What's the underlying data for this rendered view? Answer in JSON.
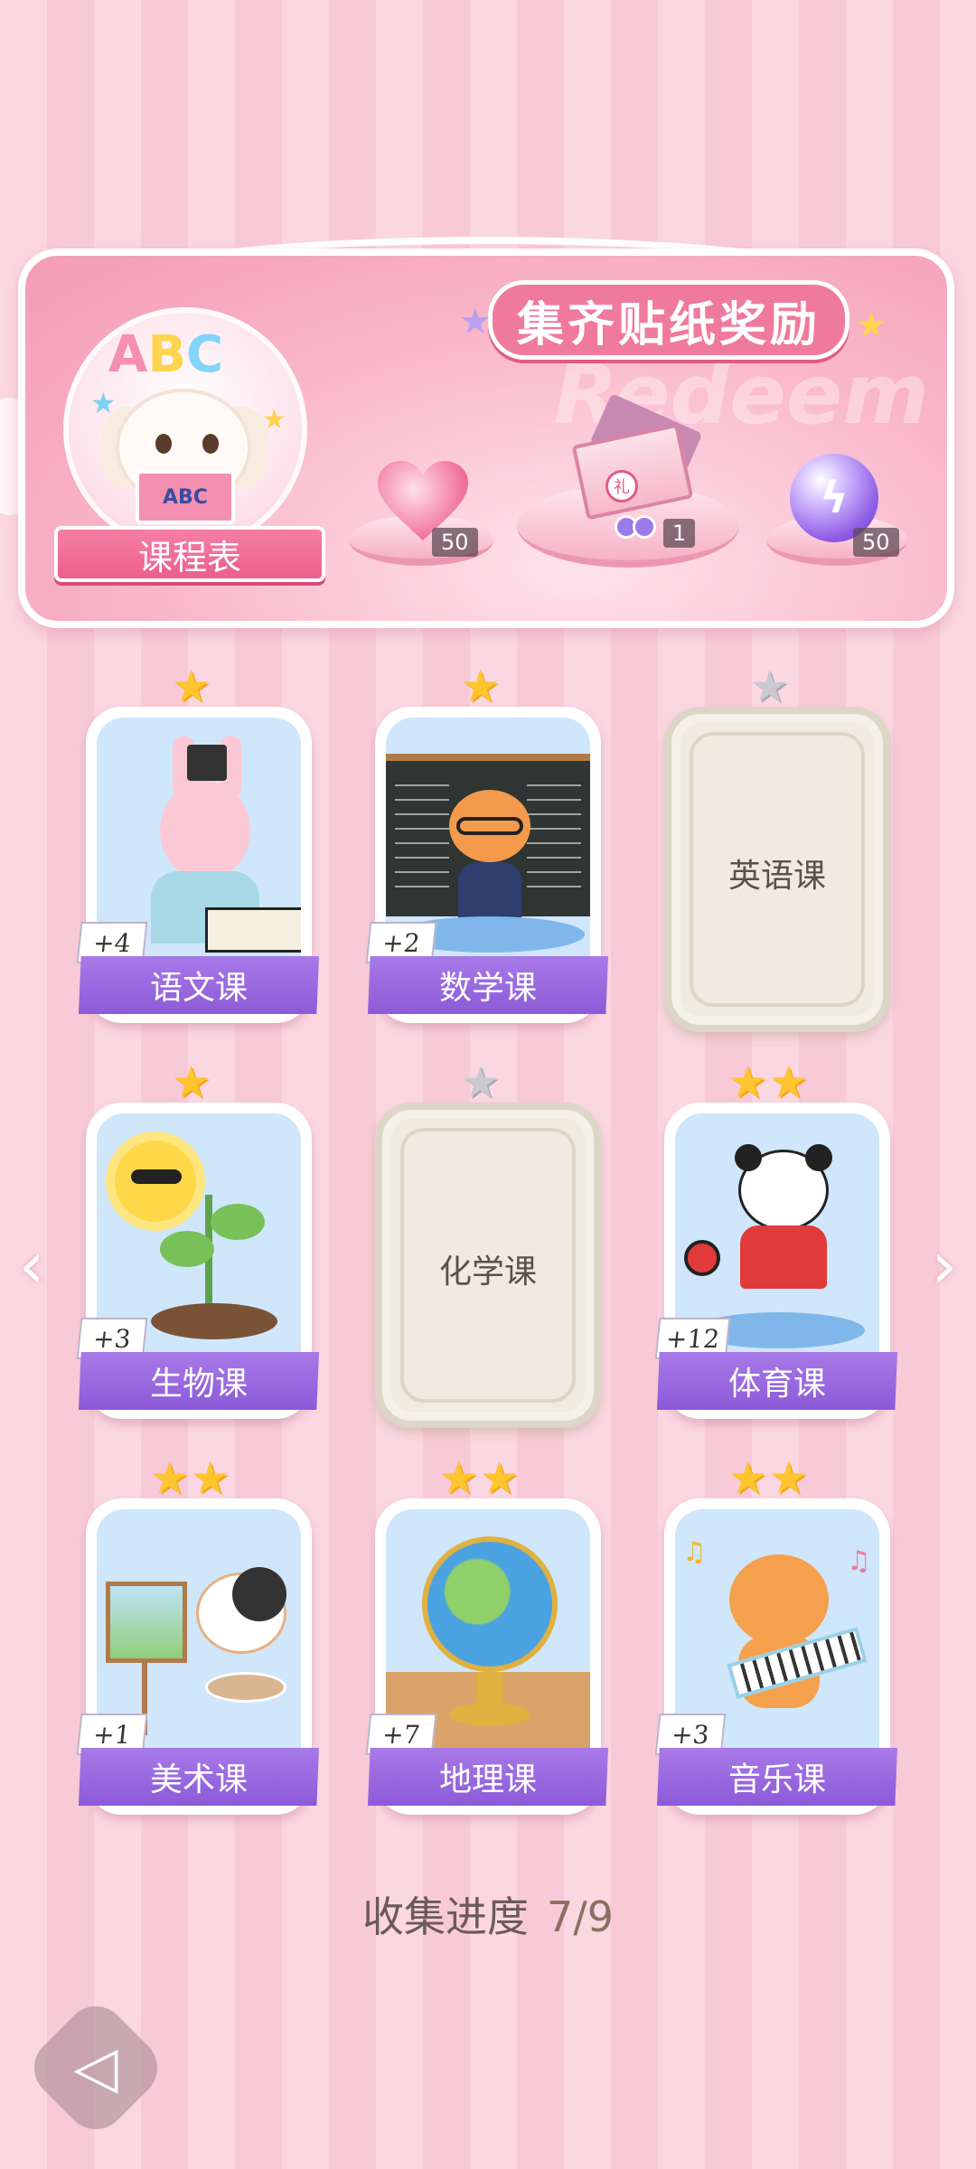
{
  "banner": {
    "title": "集齐贴纸奖励",
    "watermark": "Redeem",
    "schedule_label": "课程表",
    "avatar_letters": [
      "A",
      "B",
      "C"
    ],
    "book_text": "ABC",
    "rewards": [
      {
        "name": "pink-heart-gem",
        "count": "50"
      },
      {
        "name": "gift-box",
        "count": "1",
        "badge": "礼"
      },
      {
        "name": "energy-orb",
        "count": "50"
      }
    ]
  },
  "cards": [
    {
      "name": "语文课",
      "stars": 1,
      "collected": true,
      "bonus": "+4"
    },
    {
      "name": "数学课",
      "stars": 1,
      "collected": true,
      "bonus": "+2"
    },
    {
      "name": "英语课",
      "stars": 1,
      "collected": false
    },
    {
      "name": "生物课",
      "stars": 1,
      "collected": true,
      "bonus": "+3"
    },
    {
      "name": "化学课",
      "stars": 1,
      "collected": false
    },
    {
      "name": "体育课",
      "stars": 2,
      "collected": true,
      "bonus": "+12"
    },
    {
      "name": "美术课",
      "stars": 2,
      "collected": true,
      "bonus": "+1"
    },
    {
      "name": "地理课",
      "stars": 2,
      "collected": true,
      "bonus": "+7"
    },
    {
      "name": "音乐课",
      "stars": 2,
      "collected": true,
      "bonus": "+3"
    }
  ],
  "progress": {
    "label": "收集进度",
    "value": "7/9"
  },
  "icons": {
    "prev": "chevron-left-icon",
    "next": "chevron-right-icon",
    "back": "back-arrow-icon",
    "star": "star-icon"
  },
  "colors": {
    "label_purple": "#9966e0",
    "banner_pink": "#f39bb6",
    "star_gold": "#ffc52e",
    "star_grey": "#c9c9cf"
  }
}
